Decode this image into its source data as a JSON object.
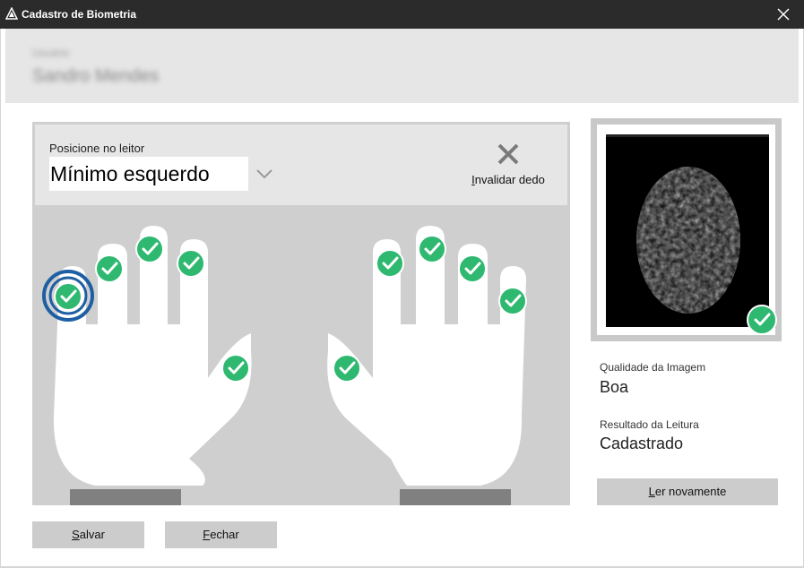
{
  "window": {
    "title": "Cadastro de Biometria"
  },
  "header": {
    "label": "Usuário",
    "name": "Sandro Mendes"
  },
  "reader": {
    "position_label": "Posicione no leitor",
    "finger_selected": "Mínimo esquerdo",
    "invalidate_label": "Invalidar dedo"
  },
  "fingers": {
    "left": [
      "registered",
      "registered",
      "registered",
      "registered",
      "registered"
    ],
    "right": [
      "registered",
      "registered",
      "registered",
      "registered",
      "registered"
    ],
    "current": "left-pinky"
  },
  "preview": {
    "status": "registered"
  },
  "info": {
    "quality_label": "Qualidade da Imagem",
    "quality_value": "Boa",
    "result_label": "Resultado da Leitura",
    "result_value": "Cadastrado"
  },
  "buttons": {
    "reread_label": "Ler novamente",
    "save_label": "Salvar",
    "close_label": "Fechar"
  },
  "colors": {
    "check": "#2eb870",
    "ring": "#1e5fa3",
    "panel": "#cfcfcf",
    "button": "#cccccc"
  }
}
